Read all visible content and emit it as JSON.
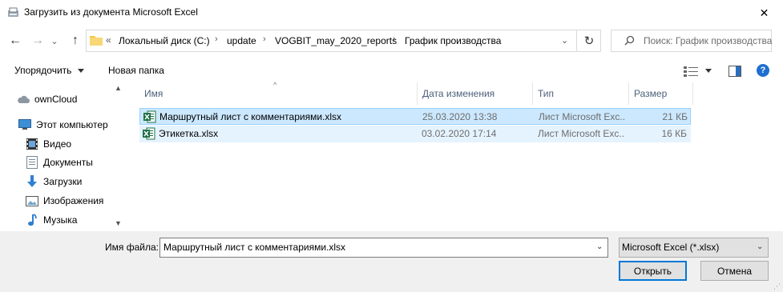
{
  "window": {
    "title": "Загрузить из документа Microsoft Excel",
    "close_glyph": "✕"
  },
  "nav": {
    "back_glyph": "←",
    "forward_glyph": "→",
    "recent_glyph": "⌄",
    "up_glyph": "↑",
    "overflow_glyph": "«",
    "crumbs": [
      "Локальный диск (C:)",
      "update",
      "VOGBIT_may_2020_reports",
      "График производства"
    ],
    "crumb_sep": "›",
    "dropdown_glyph": "⌄",
    "refresh_glyph": "↻"
  },
  "search": {
    "placeholder": "Поиск: График производства"
  },
  "toolbar": {
    "organize_label": "Упорядочить",
    "new_folder_label": "Новая папка",
    "help_glyph": "?"
  },
  "sidebar": {
    "items": [
      {
        "label": "ownCloud",
        "icon": "cloud-icon"
      },
      {
        "label": "Этот компьютер",
        "icon": "computer-icon"
      },
      {
        "label": "Видео",
        "icon": "video-icon"
      },
      {
        "label": "Документы",
        "icon": "documents-icon"
      },
      {
        "label": "Загрузки",
        "icon": "downloads-icon"
      },
      {
        "label": "Изображения",
        "icon": "pictures-icon"
      },
      {
        "label": "Музыка",
        "icon": "music-icon"
      }
    ],
    "scroll_up_glyph": "▲",
    "scroll_down_glyph": "▼"
  },
  "filelist": {
    "sort_glyph": "^",
    "columns": [
      "Имя",
      "Дата изменения",
      "Тип",
      "Размер"
    ],
    "rows": [
      {
        "name": "Маршрутный лист с комментариями.xlsx",
        "date": "25.03.2020 13:38",
        "type": "Лист Microsoft Exc...",
        "size": "21 КБ",
        "selected": true
      },
      {
        "name": "Этикетка.xlsx",
        "date": "03.02.2020 17:14",
        "type": "Лист Microsoft Exc...",
        "size": "16 КБ",
        "selected": false
      }
    ]
  },
  "bottom": {
    "filename_label": "Имя файла:",
    "filename_value": "Маршрутный лист с комментариями.xlsx",
    "filetype_value": "Microsoft Excel (*.xlsx)",
    "open_label": "Открыть",
    "cancel_label": "Отмена",
    "caret_glyph": "⌄",
    "grip_glyph": "⋰"
  },
  "colors": {
    "accent": "#0078d7",
    "selection": "#cce8ff",
    "excel_green": "#1e7145",
    "folder_yellow": "#f4c542"
  }
}
